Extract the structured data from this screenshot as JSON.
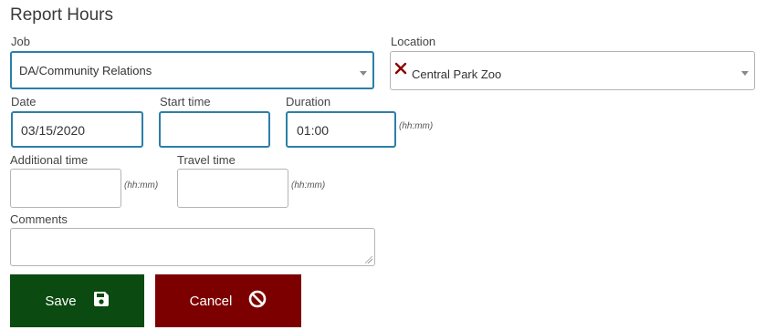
{
  "form": {
    "title": "Report Hours",
    "job": {
      "label": "Job",
      "value": "DA/Community Relations"
    },
    "location": {
      "label": "Location",
      "value": "Central Park Zoo"
    },
    "date": {
      "label": "Date",
      "value": "03/15/2020"
    },
    "start_time": {
      "label": "Start time",
      "value": ""
    },
    "duration": {
      "label": "Duration",
      "value": "01:00",
      "hint": "(hh:mm)"
    },
    "additional_time": {
      "label": "Additional time",
      "value": "",
      "hint": "(hh:mm)"
    },
    "travel_time": {
      "label": "Travel time",
      "value": "",
      "hint": "(hh:mm)"
    },
    "comments": {
      "label": "Comments",
      "value": ""
    }
  },
  "buttons": {
    "save_label": "Save",
    "cancel_label": "Cancel"
  },
  "colors": {
    "save_bg": "#0b4a10",
    "cancel_bg": "#7d0000",
    "focus_border": "#2c7fa8",
    "clear_x": "#8b0000"
  },
  "icons": {
    "save": "floppy-disk-icon",
    "cancel": "no-entry-icon",
    "clear": "clear-x-icon",
    "dropdown": "caret-down-icon"
  }
}
